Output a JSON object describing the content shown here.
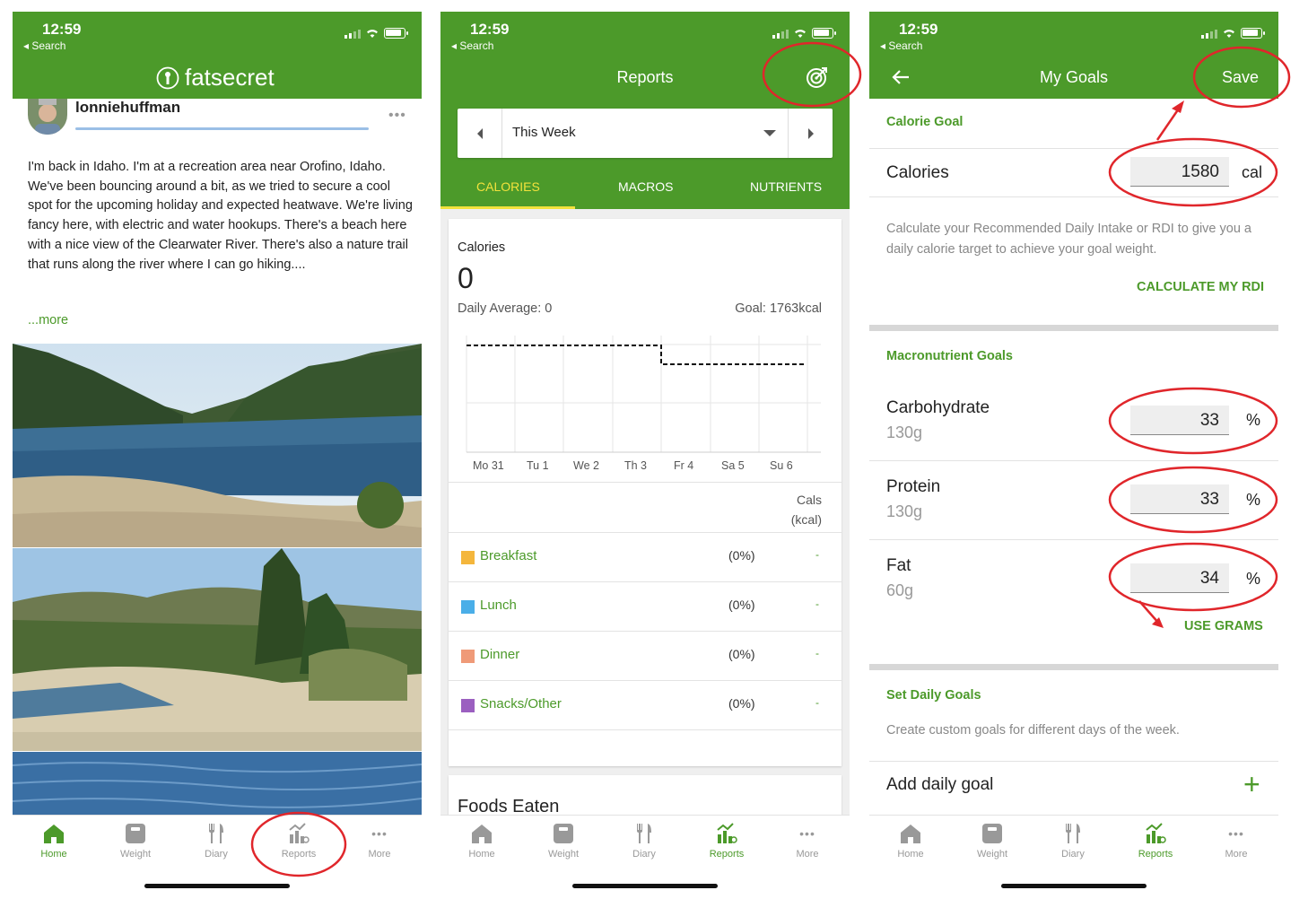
{
  "status_bar": {
    "time": "12:59",
    "back_label": "◂ Search"
  },
  "tabbar": {
    "home": "Home",
    "weight": "Weight",
    "diary": "Diary",
    "reports": "Reports",
    "more": "More"
  },
  "feed": {
    "app_name": "fatsecret",
    "username": "lonniehuffman",
    "post_text": "I'm back in Idaho.  I'm at a recreation area near Orofino, Idaho.  We've been bouncing around a bit, as we tried to secure a cool spot for the upcoming holiday and expected heatwave.  We're living fancy here, with electric and water hookups. There's a beach here with a nice view of the Clearwater River.  There's also a nature trail that runs along the river where I can go hiking....",
    "more_link": "...more"
  },
  "reports": {
    "title": "Reports",
    "period": "This Week",
    "tabs": [
      "CALORIES",
      "MACROS",
      "NUTRIENTS"
    ],
    "card_title": "Calories",
    "total": "0",
    "daily_average": "Daily Average: 0",
    "goal": "Goal: 1763kcal",
    "days": [
      "Mo 31",
      "Tu 1",
      "We 2",
      "Th 3",
      "Fr 4",
      "Sa 5",
      "Su 6"
    ],
    "col_header_1": "Cals",
    "col_header_2": "(kcal)",
    "meals": [
      {
        "name": "Breakfast",
        "pct": "(0%)",
        "value": "-",
        "color": "#f4b63c"
      },
      {
        "name": "Lunch",
        "pct": "(0%)",
        "value": "-",
        "color": "#4aaee8"
      },
      {
        "name": "Dinner",
        "pct": "(0%)",
        "value": "-",
        "color": "#ef9a78"
      },
      {
        "name": "Snacks/Other",
        "pct": "(0%)",
        "value": "-",
        "color": "#9b5fc0"
      }
    ],
    "foods_eaten": "Foods Eaten"
  },
  "goals": {
    "title": "My Goals",
    "save": "Save",
    "calorie_goal_title": "Calorie Goal",
    "calories_label": "Calories",
    "calories_value": "1580",
    "calories_unit": "cal",
    "rdi_text": "Calculate your Recommended Daily Intake or RDI to give you a daily calorie target to achieve your goal weight.",
    "rdi_link": "CALCULATE MY RDI",
    "macro_title": "Macronutrient Goals",
    "macros": [
      {
        "name": "Carbohydrate",
        "grams": "130g",
        "value": "33",
        "unit": "%"
      },
      {
        "name": "Protein",
        "grams": "130g",
        "value": "33",
        "unit": "%"
      },
      {
        "name": "Fat",
        "grams": "60g",
        "value": "34",
        "unit": "%"
      }
    ],
    "use_grams": "USE GRAMS",
    "daily_title": "Set Daily Goals",
    "daily_text": "Create custom goals for different days of the week.",
    "add_daily": "Add daily goal",
    "plus": "+"
  },
  "colors": {
    "brand_green": "#4c9a2a",
    "tab_highlight": "#f2e23c",
    "annotation_red": "#e0262b"
  }
}
